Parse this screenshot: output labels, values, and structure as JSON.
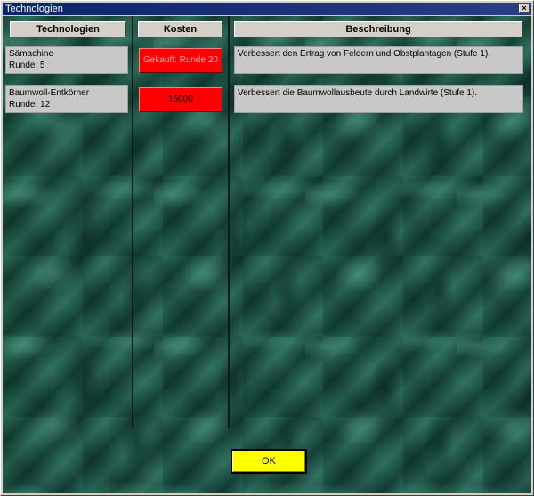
{
  "window": {
    "title": "Technologien",
    "close_glyph": "×"
  },
  "columns": {
    "tech": "Technologien",
    "cost": "Kosten",
    "desc": "Beschreibung"
  },
  "rows": [
    {
      "name": "Sämachine",
      "round": "Runde: 5",
      "cost": "Gekauft: Runde 20",
      "cost_purchased": true,
      "description": "Verbessert den Ertrag von Feldern und Obstplantagen (Stufe 1)."
    },
    {
      "name": "Baumwoll-Entkörner",
      "round": "Runde: 12",
      "cost": "15000",
      "cost_purchased": false,
      "description": "Verbessert die Baumwollausbeute durch Landwirte (Stufe 1)."
    }
  ],
  "ok_label": "OK",
  "colors": {
    "title_bar": "#0a246a",
    "cost_button": "#ff0000",
    "ok_button": "#ffff00",
    "cell_bg": "#c8c8c8"
  }
}
